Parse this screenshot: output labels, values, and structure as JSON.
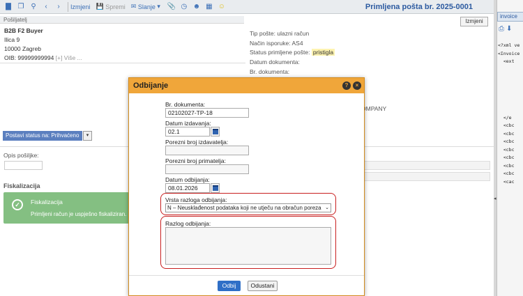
{
  "toolbar": {
    "edit_label": "Izmjeni",
    "save_label": "Spremi",
    "send_label": "Slanje",
    "title": "Primljena pošta br. 2025-0001"
  },
  "sender": {
    "header": "Pošiljatelj",
    "name": "B2B F2 Buyer",
    "street": "Ilica 9",
    "city": "10000 Zagreb",
    "oib": "OIB: 99999999994",
    "more": "[+] Više ..."
  },
  "meta": {
    "edit_label": "Izmjeni",
    "type": "Tip pošte: ulazni račun",
    "delivery": "Način isporuke: AS4",
    "status_label": "Status primljene pošte:",
    "status_value": "pristigla",
    "doc_date": "Datum dokumenta:",
    "doc_no": "Br. dokumenta:",
    "company_fragment": "OMPANY"
  },
  "status": {
    "button_label": "Postavi status na: Prihvaćeno"
  },
  "description": {
    "label": "Opis pošiljke:"
  },
  "fiscal": {
    "section": "Fiskalizacija",
    "title": "Fiskalizacija",
    "message": "Primljeni račun je uspješno fiskaliziran."
  },
  "right_panel": {
    "tab": "invoice",
    "code": "<?xml ve\n<Invoice\n  <ext\n\n\n\n\n\n\n  </e\n  <cbc\n  <cbc\n  <cbc\n  <cbc\n  <cbc\n  <cbc\n  <cbc\n  <cac"
  },
  "dialog": {
    "title": "Odbijanje",
    "doc_no_label": "Br. dokumenta:",
    "doc_no_value": "02102027-TP-18",
    "issue_date_label": "Datum izdavanja:",
    "issue_date_value": "02.1",
    "issuer_tax_label": "Porezni broj izdavatelja:",
    "receiver_tax_label": "Porezni broj primatelja:",
    "reject_date_label": "Datum odbijanja:",
    "reject_date_value": "08.01.2026",
    "reason_type_label": "Vrsta razloga odbijanja:",
    "reason_type_value": "N – Neusklađenost podataka koji ne utječu na obračun poreza",
    "reason_label": "Razlog odbijanja:",
    "reject_button": "Odbij",
    "cancel_button": "Odustani"
  }
}
